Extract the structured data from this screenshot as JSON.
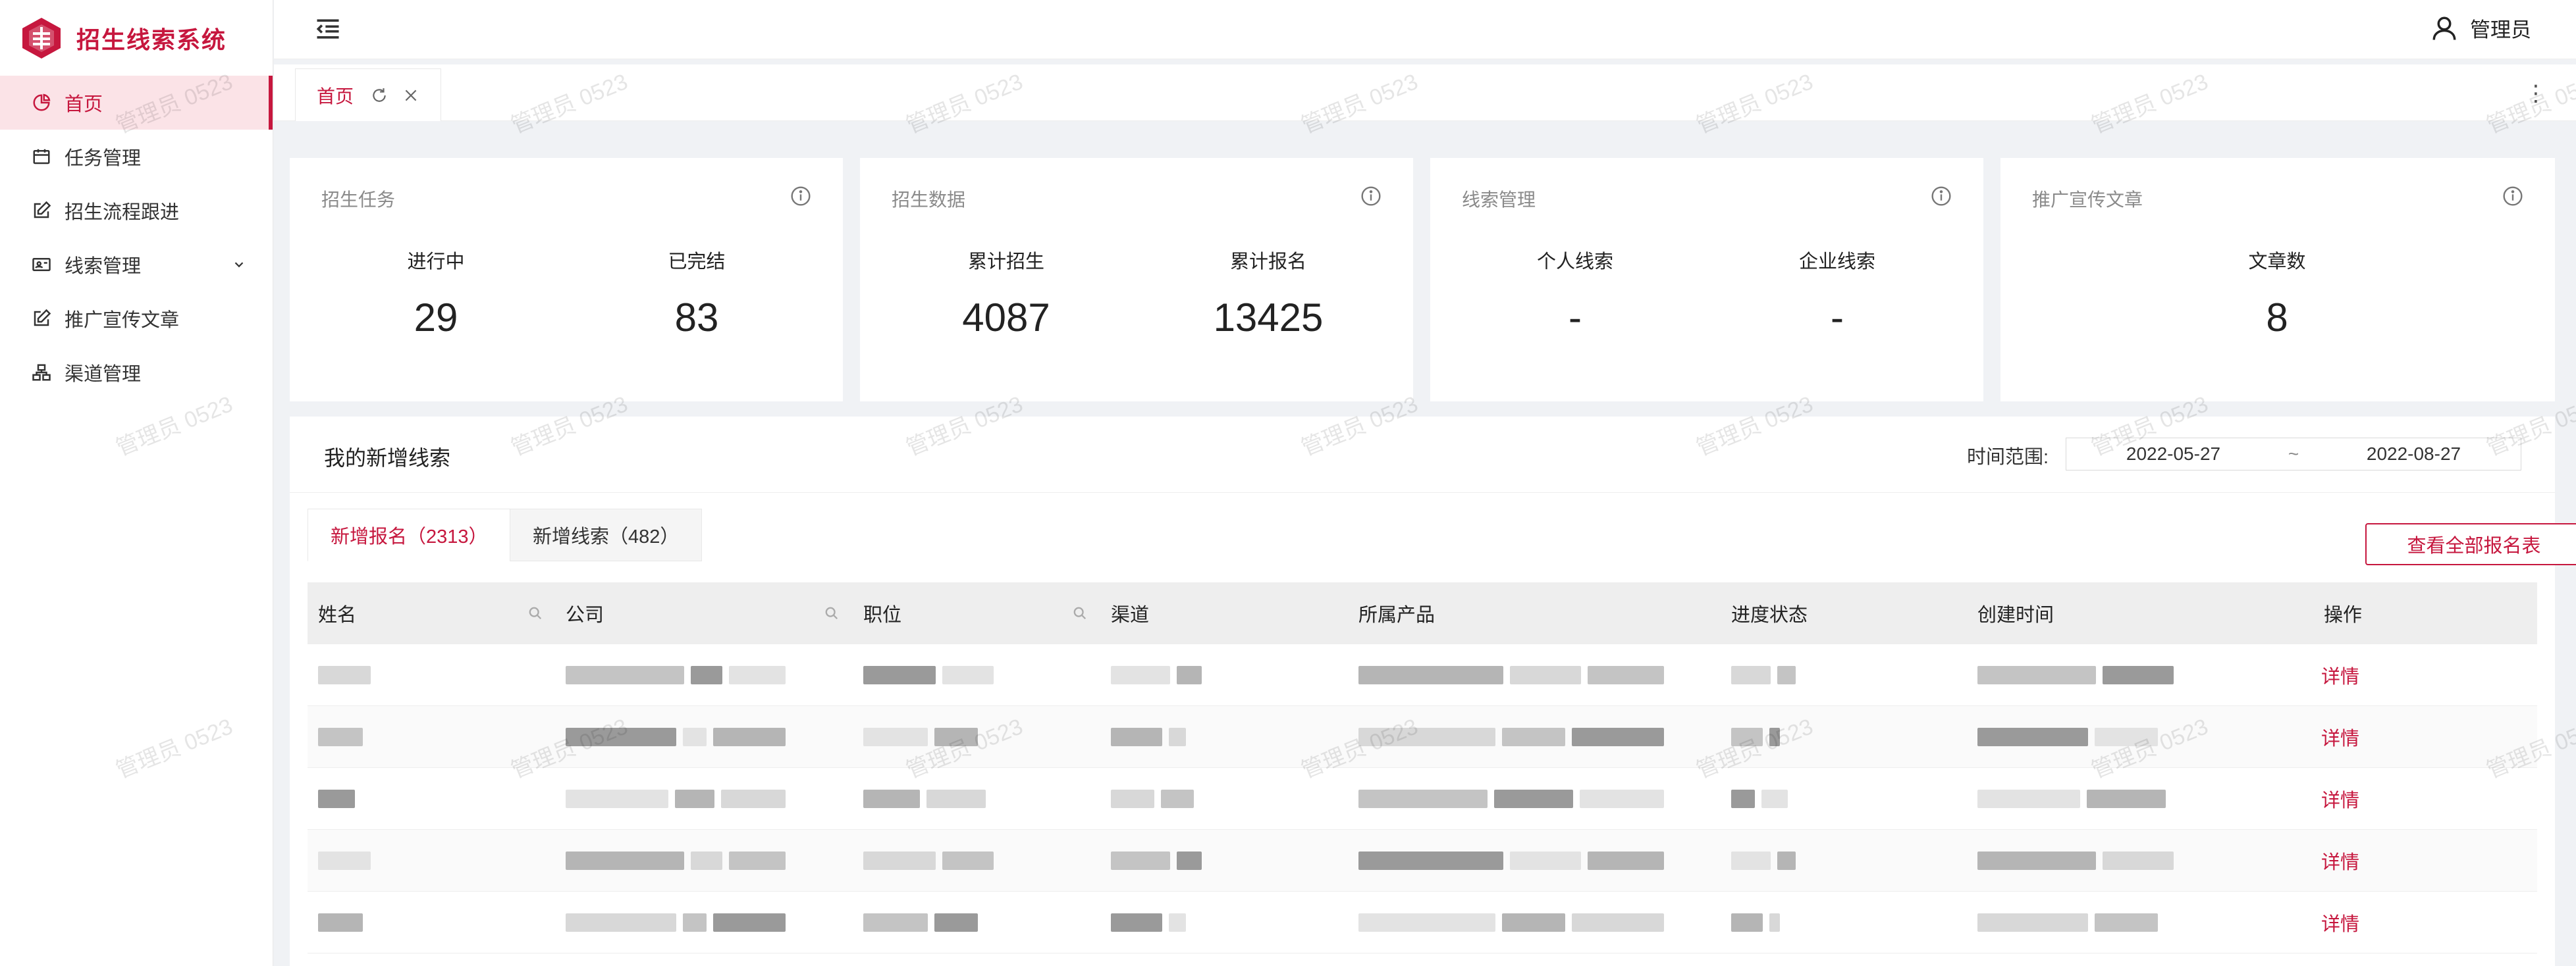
{
  "app": {
    "title": "招生线索系统"
  },
  "sidebar": {
    "items": [
      {
        "label": "首页",
        "icon": "pie-chart-icon",
        "active": true
      },
      {
        "label": "任务管理",
        "icon": "calendar-icon"
      },
      {
        "label": "招生流程跟进",
        "icon": "edit-icon"
      },
      {
        "label": "线索管理",
        "icon": "id-card-icon",
        "expandable": true
      },
      {
        "label": "推广宣传文章",
        "icon": "edit-icon"
      },
      {
        "label": "渠道管理",
        "icon": "channel-icon"
      }
    ]
  },
  "header": {
    "user": "管理员"
  },
  "tabs": [
    {
      "label": "首页"
    }
  ],
  "cards": [
    {
      "title": "招生任务",
      "stats": [
        {
          "label": "进行中",
          "value": "29"
        },
        {
          "label": "已完结",
          "value": "83"
        }
      ]
    },
    {
      "title": "招生数据",
      "stats": [
        {
          "label": "累计招生",
          "value": "4087"
        },
        {
          "label": "累计报名",
          "value": "13425"
        }
      ]
    },
    {
      "title": "线索管理",
      "stats": [
        {
          "label": "个人线索",
          "value": "-"
        },
        {
          "label": "企业线索",
          "value": "-"
        }
      ]
    },
    {
      "title": "推广宣传文章",
      "stats": [
        {
          "label": "文章数",
          "value": "8"
        }
      ]
    }
  ],
  "leads": {
    "title": "我的新增线索",
    "range_label": "时间范围:",
    "range_start": "2022-05-27",
    "range_sep": "~",
    "range_end": "2022-08-27",
    "sub_tabs": [
      "新增报名（2313）",
      "新增线索（482）"
    ],
    "view_all": "查看全部报名表",
    "columns": [
      "姓名",
      "公司",
      "职位",
      "渠道",
      "所属产品",
      "进度状态",
      "创建时间",
      "操作"
    ],
    "row_action": "详情",
    "row_count": 5
  },
  "watermark": "管理员 0523",
  "colors": {
    "accent": "#c6173e",
    "accent_bg": "#fbe3e7",
    "page_bg": "#f0f2f5"
  }
}
